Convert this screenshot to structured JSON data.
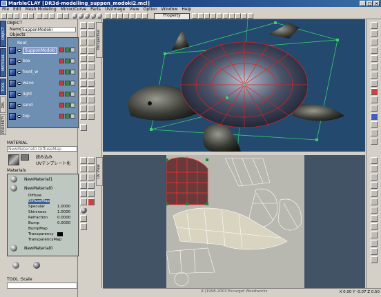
{
  "window": {
    "app_name": "MarbleCLAY",
    "file": "[DR3d-modelling_suppon_modoki2.mcl]"
  },
  "menu": [
    "File",
    "Edit",
    "Mesh Modeling",
    "Mirror/Curve",
    "Parts",
    "UV/Image",
    "View",
    "Option",
    "Window",
    "Help"
  ],
  "toolbar": {
    "property_label": "Property"
  },
  "side_tabs": [
    "OBJECT",
    "MATERIAL",
    "TOOL",
    "DEL",
    "PROPERTY"
  ],
  "object_panel": {
    "title": "OBJECT",
    "name_label": "Name",
    "name_value": "SupponModoki",
    "objects_label": "Objects",
    "root_label": "Root",
    "items": [
      {
        "label": "SupponModoki",
        "selected": true
      },
      {
        "label": "box",
        "selected": false
      },
      {
        "label": "front_w",
        "selected": false
      },
      {
        "label": "wave",
        "selected": false
      },
      {
        "label": "light",
        "selected": false
      },
      {
        "label": "sand",
        "selected": false
      },
      {
        "label": "top",
        "selected": false
      }
    ]
  },
  "material_panel": {
    "title": "MATERIAL",
    "name_value": "NewMaterial0 DiffuseMap",
    "load_label": "読み込み",
    "uv_label": "UVテンプレート化",
    "materials_label": "Materials",
    "entries": [
      {
        "label": "NewMaterial1"
      },
      {
        "label": "NewMaterial0"
      },
      {
        "label": "NewMaterial0"
      }
    ],
    "properties": [
      {
        "name": "Diffuse",
        "value": ""
      },
      {
        "name": "DiffuseMap",
        "value": ""
      },
      {
        "name": "Specular",
        "value": "1.0000"
      },
      {
        "name": "Shininess",
        "value": "1.0000"
      },
      {
        "name": "Refraction",
        "value": "0.0000"
      },
      {
        "name": "Bump",
        "value": "0.0000"
      },
      {
        "name": "BumpMap",
        "value": ""
      },
      {
        "name": "Transparency",
        "value": ""
      },
      {
        "name": "TransparencyMap",
        "value": ""
      }
    ]
  },
  "tool_panel": {
    "label": "TOOL :Scale"
  },
  "viewports": {
    "top_label": "Perspective",
    "bottom_label": "UV View"
  },
  "status": {
    "copyright": "(C)1998-2003 Escargot Woodworks",
    "coords": "X 0.00  Y -0.07  Z 0.50"
  },
  "colors": {
    "accent": "#0a246a",
    "viewport_bg": "#234a6e",
    "selection": "#e02020"
  }
}
